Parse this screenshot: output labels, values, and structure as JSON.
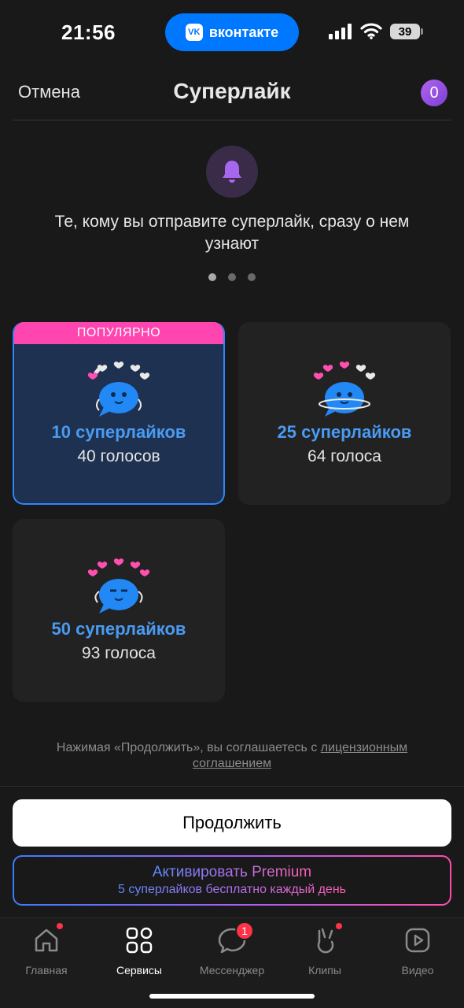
{
  "status_bar": {
    "time": "21:56",
    "app_pill": "вконтакте",
    "vk_logo": "VK",
    "battery": "39"
  },
  "header": {
    "cancel": "Отмена",
    "title": "Суперлайк",
    "counter": "0"
  },
  "promo": {
    "icon": "bell-icon",
    "text": "Те, кому вы отправите суперлайк, сразу о нем узнают",
    "pages": 3,
    "active_page": 1
  },
  "packs": [
    {
      "badge": "ПОПУЛЯРНО",
      "title": "10 суперлайков",
      "price": "40 голосов",
      "selected": true
    },
    {
      "title": "25 суперлайков",
      "price": "64 голоса",
      "selected": false
    },
    {
      "title": "50 суперлайков",
      "price": "93 голоса",
      "selected": false
    }
  ],
  "legal": {
    "prefix": "Нажимая «Продолжить», вы соглашаетесь с ",
    "link": "лицензионным соглашением"
  },
  "buttons": {
    "continue": "Продолжить",
    "premium_title": "Активировать Premium",
    "premium_subtitle": "5 суперлайков бесплатно каждый день"
  },
  "tabbar": [
    {
      "label": "Главная",
      "icon": "home-icon",
      "dot": true
    },
    {
      "label": "Сервисы",
      "icon": "services-icon",
      "active": true
    },
    {
      "label": "Мессенджер",
      "icon": "messenger-icon",
      "badge": "1"
    },
    {
      "label": "Клипы",
      "icon": "clips-icon",
      "dot": true
    },
    {
      "label": "Видео",
      "icon": "video-icon"
    }
  ],
  "colors": {
    "accent": "#0077ff",
    "popular": "#ff46b0",
    "pack_title": "#4a9bf2",
    "badge": "#ff3347",
    "counter": "#a05ae8"
  }
}
